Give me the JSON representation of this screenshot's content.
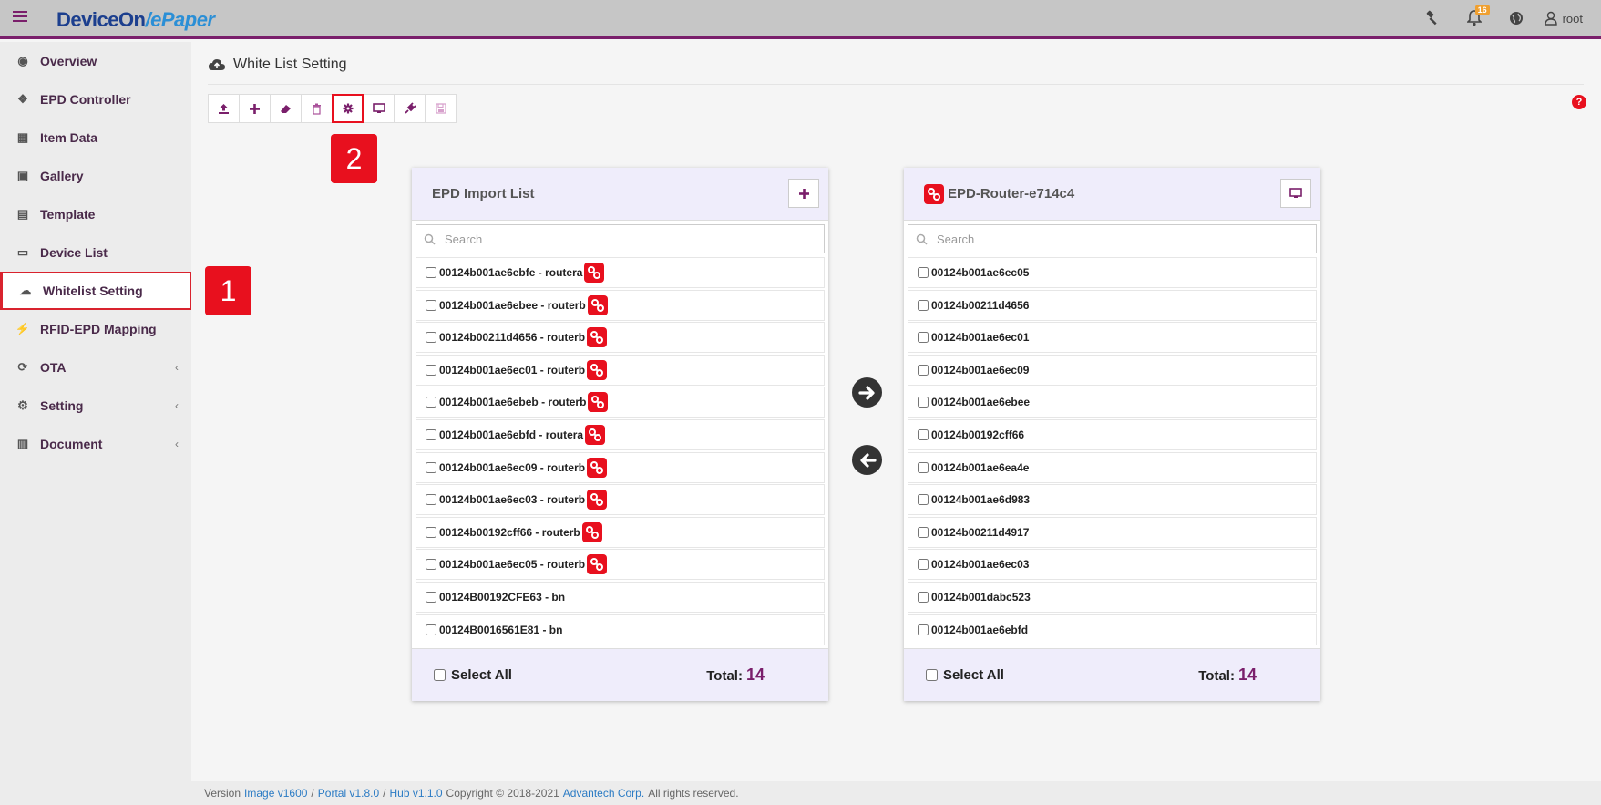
{
  "brand": {
    "part1": "DeviceOn",
    "part2": "/ePaper"
  },
  "topbar": {
    "notifications_count": "16",
    "user": "root"
  },
  "sidebar": {
    "items": [
      {
        "label": "Overview",
        "icon": "globe-icon",
        "glyph": "◉"
      },
      {
        "label": "EPD Controller",
        "icon": "tags-icon",
        "glyph": "❖"
      },
      {
        "label": "Item Data",
        "icon": "table-icon",
        "glyph": "▦"
      },
      {
        "label": "Gallery",
        "icon": "image-icon",
        "glyph": "▣"
      },
      {
        "label": "Template",
        "icon": "id-card-icon",
        "glyph": "▤"
      },
      {
        "label": "Device List",
        "icon": "monitor-icon",
        "glyph": "▭"
      },
      {
        "label": "Whitelist Setting",
        "icon": "cloud-upload-icon",
        "glyph": "☁",
        "active": true
      },
      {
        "label": "RFID-EPD Mapping",
        "icon": "plug-icon",
        "glyph": "⚡"
      },
      {
        "label": "OTA",
        "icon": "refresh-icon",
        "glyph": "⟳",
        "chevron": "‹"
      },
      {
        "label": "Setting",
        "icon": "gears-icon",
        "glyph": "⚙",
        "chevron": "‹"
      },
      {
        "label": "Document",
        "icon": "book-icon",
        "glyph": "▥",
        "chevron": "‹"
      }
    ]
  },
  "callouts": {
    "one": "1",
    "two": "2"
  },
  "page": {
    "title": "White List Setting"
  },
  "import_list": {
    "title": "EPD Import List",
    "search_placeholder": "Search",
    "items": [
      {
        "label": "00124b001ae6ebfe - routera",
        "router": true
      },
      {
        "label": "00124b001ae6ebee - routerb",
        "router": true
      },
      {
        "label": "00124b00211d4656 - routerb",
        "router": true
      },
      {
        "label": "00124b001ae6ec01 - routerb",
        "router": true
      },
      {
        "label": "00124b001ae6ebeb - routerb",
        "router": true
      },
      {
        "label": "00124b001ae6ebfd - routera",
        "router": true
      },
      {
        "label": "00124b001ae6ec09 - routerb",
        "router": true
      },
      {
        "label": "00124b001ae6ec03 - routerb",
        "router": true
      },
      {
        "label": "00124b00192cff66 - routerb",
        "router": true
      },
      {
        "label": "00124b001ae6ec05 - routerb",
        "router": true
      },
      {
        "label": "00124B00192CFE63 - bn",
        "router": false
      },
      {
        "label": "00124B0016561E81 - bn",
        "router": false
      }
    ],
    "select_all": "Select All",
    "total_label": "Total:",
    "total": "14"
  },
  "router_list": {
    "title": "EPD-Router-e714c4",
    "search_placeholder": "Search",
    "items": [
      "00124b001ae6ec05",
      "00124b00211d4656",
      "00124b001ae6ec01",
      "00124b001ae6ec09",
      "00124b001ae6ebee",
      "00124b00192cff66",
      "00124b001ae6ea4e",
      "00124b001ae6d983",
      "00124b00211d4917",
      "00124b001ae6ec03",
      "00124b001dabc523",
      "00124b001ae6ebfd"
    ],
    "select_all": "Select All",
    "total_label": "Total:",
    "total": "14"
  },
  "footer": {
    "version": "Version",
    "image": "Image v1600",
    "portal": "Portal v1.8.0",
    "hub": "Hub v1.1.0",
    "copyright": "Copyright © 2018-2021",
    "company": "Advantech Corp.",
    "rights": "All rights reserved."
  },
  "colors": {
    "accent": "#7a1f6b",
    "highlight": "#e8101e",
    "panel_header": "#efedfb"
  }
}
